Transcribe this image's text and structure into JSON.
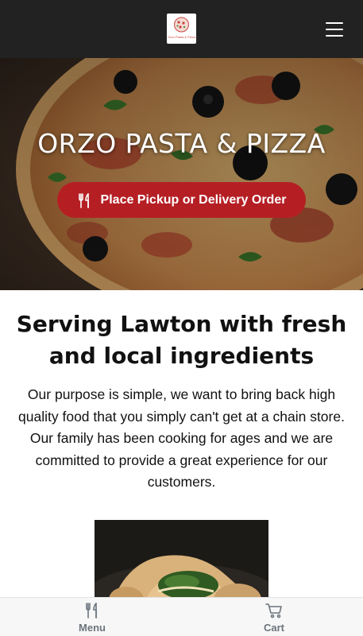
{
  "header": {
    "logo_text": "Orzo Pasta & Pizza",
    "menu_toggle_icon": "hamburger-icon"
  },
  "hero": {
    "title": "ORZO PASTA & PIZZA",
    "order_button_label": "Place Pickup or Delivery Order",
    "order_button_icon": "fork-knife-icon",
    "accent_color": "#b51f24"
  },
  "intro": {
    "headline": "Serving Lawton with fresh and local ingredients",
    "body": "Our purpose is simple, we want to bring back high quality food that you simply can't get at a chain store. Our family has been cooking for ages and we are committed to provide a great experience for our customers."
  },
  "bottom_nav": {
    "items": [
      {
        "label": "Menu",
        "icon": "fork-knife-icon"
      },
      {
        "label": "Cart",
        "icon": "cart-icon"
      }
    ]
  }
}
